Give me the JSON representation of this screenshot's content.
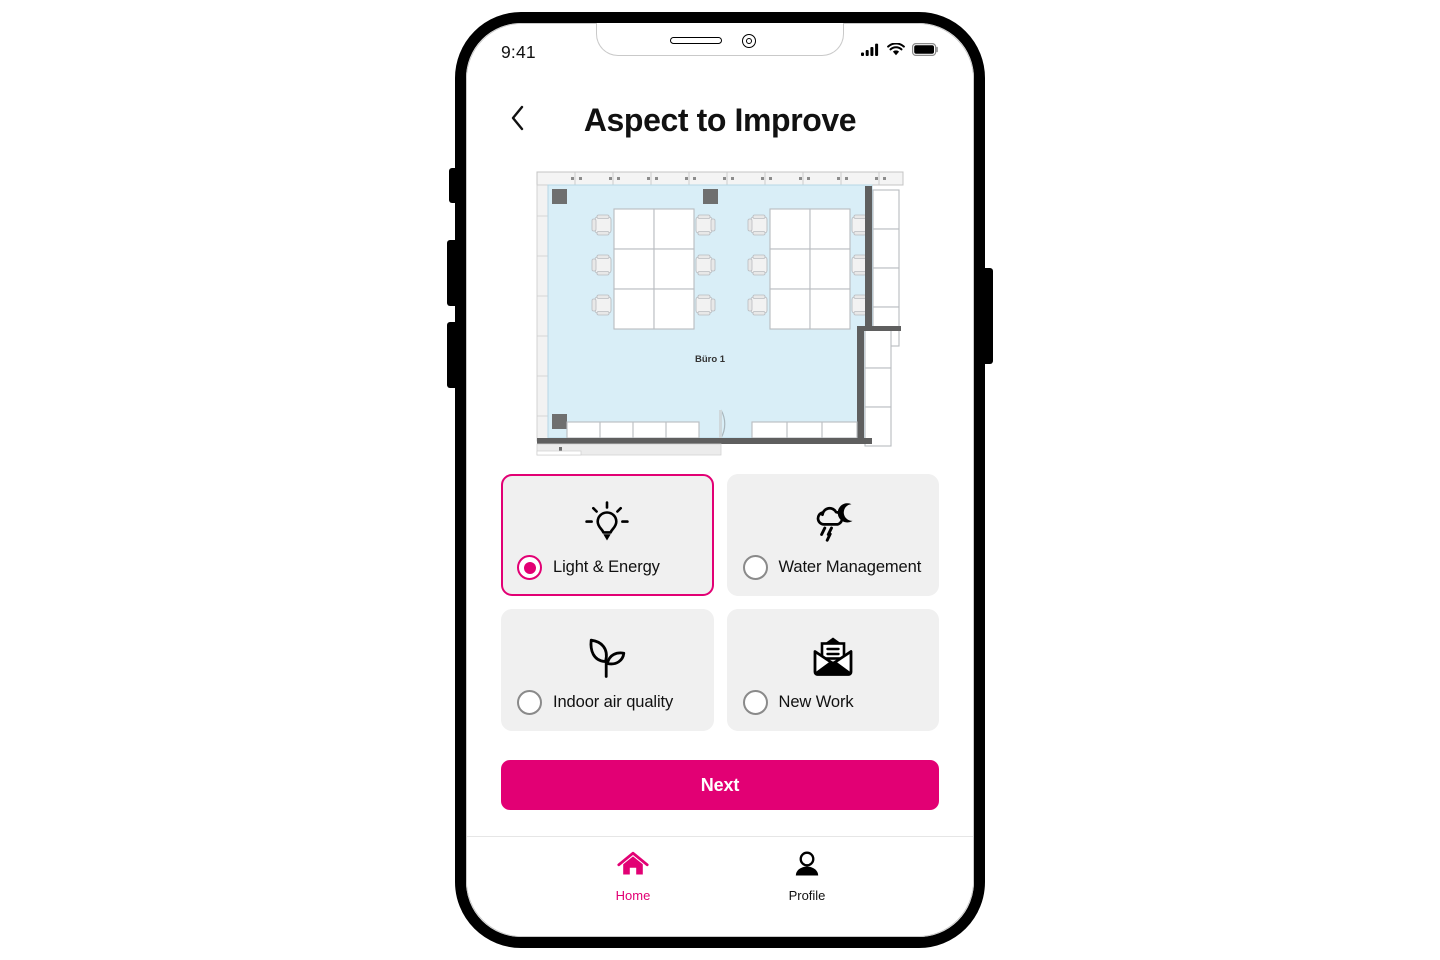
{
  "device": {
    "type": "smartphone-mockup",
    "status_bar": {
      "time": "9:41",
      "icons": [
        "cellular-signal-icon",
        "wifi-icon",
        "battery-icon"
      ]
    },
    "hardware": [
      "mute-switch",
      "volume-up-button",
      "volume-down-button",
      "power-button",
      "earpiece-speaker",
      "front-camera"
    ]
  },
  "colors": {
    "accent": "#E20074",
    "card_background": "#F0F0F0",
    "text": "#111111",
    "radio_border": "#8a8a8a",
    "floorplan_room_fill": "#D9EEF7",
    "floorplan_wall": "#5f5f5f"
  },
  "header": {
    "back_icon": "chevron-left-icon",
    "title": "Aspect to Improve"
  },
  "floorplan": {
    "room_label": "Büro 1",
    "alt": "office floor plan with two desk clusters, chairs, cabinets and a door"
  },
  "options": [
    {
      "id": "light-energy",
      "label": "Light & Energy",
      "icon": "lightbulb-icon",
      "selected": true
    },
    {
      "id": "water-management",
      "label": "Water Management",
      "icon": "rain-cloud-moon-icon",
      "selected": false
    },
    {
      "id": "indoor-air-quality",
      "label": "Indoor air quality",
      "icon": "sprout-leaf-icon",
      "selected": false
    },
    {
      "id": "new-work",
      "label": "New Work",
      "icon": "open-envelope-icon",
      "selected": false
    }
  ],
  "primary_action": {
    "label": "Next"
  },
  "bottom_nav": [
    {
      "id": "home",
      "label": "Home",
      "icon": "home-icon",
      "active": true
    },
    {
      "id": "profile",
      "label": "Profile",
      "icon": "person-icon",
      "active": false
    }
  ]
}
